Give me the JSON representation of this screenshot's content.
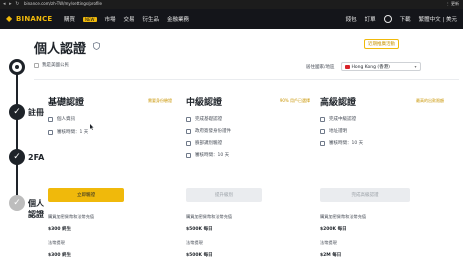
{
  "browser": {
    "url": "binance.com/zh-TW/my/settings/profile",
    "nav": "◂ ▸ ↻",
    "ext": "⋮ 更新"
  },
  "header": {
    "logo_text": "BINANCE",
    "nav": [
      "購買",
      "市場",
      "交易",
      "衍生品",
      "金融業務"
    ],
    "nav_badge": "NEW",
    "right": [
      "錢包",
      "訂單",
      "下載",
      "繁體中文 | 美元"
    ]
  },
  "page": {
    "title": "個人認證",
    "promo": "近期推廣活動",
    "checkbox_label": "我是美國公民",
    "region_label": "居住國家/地區",
    "region_value": "Hong Kong (香港)"
  },
  "timeline": {
    "steps": [
      "註冊",
      "2FA",
      "個人認證"
    ]
  },
  "cards": [
    {
      "title": "基礎認證",
      "tag": "需要身份驗證",
      "features": [
        "個人資訊",
        "審核時間：1 天"
      ],
      "button": "立即驗證",
      "limit_label": "購買加密貨幣和法幣充值",
      "limit_values": [
        "$300 終生",
        "$300 終生"
      ],
      "limit_label2": "法幣提現"
    },
    {
      "title": "中級認證",
      "tag": "90% 用戶已選擇",
      "features": [
        "完成基礎認證",
        "政府簽發身份證件",
        "臉部識別驗證",
        "審核時間：10 天"
      ],
      "button": "提升級別",
      "limit_label": "購買加密貨幣和法幣充值",
      "limit_values": [
        "$500K 每日",
        "$500K 每日"
      ],
      "limit_label2": "法幣提現"
    },
    {
      "title": "高級認證",
      "tag": "最高的出款限額",
      "features": [
        "完成中級認證",
        "地址證明",
        "審核時間：10 天"
      ],
      "button": "完成高級認證",
      "limit_label": "購買加密貨幣和法幣充值",
      "limit_values": [
        "$200K 每日",
        "$2M 每日"
      ],
      "limit_label2": "法幣提現"
    }
  ]
}
